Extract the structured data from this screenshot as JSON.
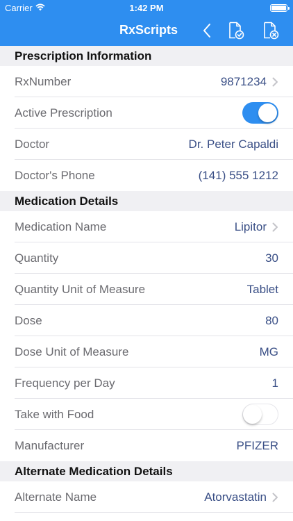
{
  "status_bar": {
    "carrier": "Carrier",
    "time": "1:42 PM",
    "wifi_icon": "wifi-icon",
    "battery_icon": "battery-icon"
  },
  "nav": {
    "title": "RxScripts",
    "back_icon": "chevron-left-icon",
    "approve_icon": "document-check-icon",
    "reject_icon": "document-x-icon"
  },
  "sections": {
    "prescription": {
      "title": "Prescription Information",
      "rx_number": {
        "label": "RxNumber",
        "value": "9871234"
      },
      "active": {
        "label": "Active Prescription",
        "on": true
      },
      "doctor": {
        "label": "Doctor",
        "value": "Dr. Peter Capaldi"
      },
      "doctor_phone": {
        "label": "Doctor's Phone",
        "value": "(141) 555 1212"
      }
    },
    "medication": {
      "title": "Medication Details",
      "name": {
        "label": "Medication Name",
        "value": "Lipitor"
      },
      "quantity": {
        "label": "Quantity",
        "value": "30"
      },
      "quantity_uom": {
        "label": "Quantity Unit of Measure",
        "value": "Tablet"
      },
      "dose": {
        "label": "Dose",
        "value": "80"
      },
      "dose_uom": {
        "label": "Dose Unit of Measure",
        "value": "MG"
      },
      "frequency": {
        "label": "Frequency per Day",
        "value": "1"
      },
      "take_with_food": {
        "label": "Take with Food",
        "on": false
      },
      "manufacturer": {
        "label": "Manufacturer",
        "value": "PFIZER"
      }
    },
    "alternate": {
      "title": "Alternate Medication Details",
      "name": {
        "label": "Alternate Name",
        "value": "Atorvastatin"
      }
    }
  },
  "colors": {
    "accent": "#2e8ef0",
    "value_text": "#3a4f86",
    "label_text": "#6b6b70",
    "section_bg": "#f0f0f3"
  }
}
